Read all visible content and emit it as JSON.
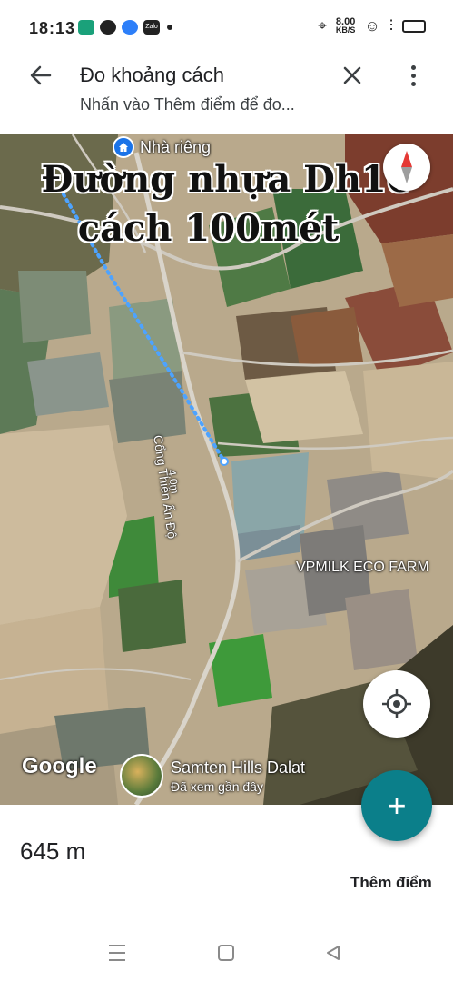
{
  "status_bar": {
    "time": "18:13",
    "speed_value": "8.00",
    "speed_unit": "KB/S",
    "app_icons": [
      "messenger-icon",
      "chat-icon",
      "messenger-icon",
      "zalo-icon"
    ],
    "zalo_label": "Zalo"
  },
  "app_bar": {
    "title": "Đo khoảng cách",
    "subtitle": "Nhấn vào Thêm điểm để đo..."
  },
  "map": {
    "home_label": "Nhà riêng",
    "caption_line1": "Đường nhựa Dh16",
    "caption_line2": "cách 100mét",
    "road_label": "Cổng Thiền Ấn Độ",
    "road_sub": "4.0m",
    "farm_label": "VPMILK ECO FARM",
    "google_logo": "Google",
    "place_name": "Samten Hills Dalat",
    "place_sub": "Đã xem gần đây"
  },
  "bottom": {
    "distance": "645 m",
    "add_point_label": "Thêm điểm"
  },
  "colors": {
    "fab": "#0b7f8a",
    "measure_line": "#4da3ff",
    "home_pin": "#1a73e8"
  }
}
